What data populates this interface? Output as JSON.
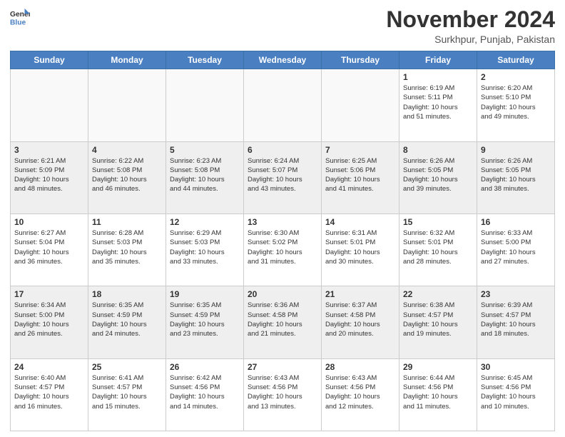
{
  "header": {
    "logo_general": "General",
    "logo_blue": "Blue",
    "month_title": "November 2024",
    "location": "Surkhpur, Punjab, Pakistan"
  },
  "weekdays": [
    "Sunday",
    "Monday",
    "Tuesday",
    "Wednesday",
    "Thursday",
    "Friday",
    "Saturday"
  ],
  "weeks": [
    [
      {
        "day": "",
        "info": ""
      },
      {
        "day": "",
        "info": ""
      },
      {
        "day": "",
        "info": ""
      },
      {
        "day": "",
        "info": ""
      },
      {
        "day": "",
        "info": ""
      },
      {
        "day": "1",
        "info": "Sunrise: 6:19 AM\nSunset: 5:11 PM\nDaylight: 10 hours\nand 51 minutes."
      },
      {
        "day": "2",
        "info": "Sunrise: 6:20 AM\nSunset: 5:10 PM\nDaylight: 10 hours\nand 49 minutes."
      }
    ],
    [
      {
        "day": "3",
        "info": "Sunrise: 6:21 AM\nSunset: 5:09 PM\nDaylight: 10 hours\nand 48 minutes."
      },
      {
        "day": "4",
        "info": "Sunrise: 6:22 AM\nSunset: 5:08 PM\nDaylight: 10 hours\nand 46 minutes."
      },
      {
        "day": "5",
        "info": "Sunrise: 6:23 AM\nSunset: 5:08 PM\nDaylight: 10 hours\nand 44 minutes."
      },
      {
        "day": "6",
        "info": "Sunrise: 6:24 AM\nSunset: 5:07 PM\nDaylight: 10 hours\nand 43 minutes."
      },
      {
        "day": "7",
        "info": "Sunrise: 6:25 AM\nSunset: 5:06 PM\nDaylight: 10 hours\nand 41 minutes."
      },
      {
        "day": "8",
        "info": "Sunrise: 6:26 AM\nSunset: 5:05 PM\nDaylight: 10 hours\nand 39 minutes."
      },
      {
        "day": "9",
        "info": "Sunrise: 6:26 AM\nSunset: 5:05 PM\nDaylight: 10 hours\nand 38 minutes."
      }
    ],
    [
      {
        "day": "10",
        "info": "Sunrise: 6:27 AM\nSunset: 5:04 PM\nDaylight: 10 hours\nand 36 minutes."
      },
      {
        "day": "11",
        "info": "Sunrise: 6:28 AM\nSunset: 5:03 PM\nDaylight: 10 hours\nand 35 minutes."
      },
      {
        "day": "12",
        "info": "Sunrise: 6:29 AM\nSunset: 5:03 PM\nDaylight: 10 hours\nand 33 minutes."
      },
      {
        "day": "13",
        "info": "Sunrise: 6:30 AM\nSunset: 5:02 PM\nDaylight: 10 hours\nand 31 minutes."
      },
      {
        "day": "14",
        "info": "Sunrise: 6:31 AM\nSunset: 5:01 PM\nDaylight: 10 hours\nand 30 minutes."
      },
      {
        "day": "15",
        "info": "Sunrise: 6:32 AM\nSunset: 5:01 PM\nDaylight: 10 hours\nand 28 minutes."
      },
      {
        "day": "16",
        "info": "Sunrise: 6:33 AM\nSunset: 5:00 PM\nDaylight: 10 hours\nand 27 minutes."
      }
    ],
    [
      {
        "day": "17",
        "info": "Sunrise: 6:34 AM\nSunset: 5:00 PM\nDaylight: 10 hours\nand 26 minutes."
      },
      {
        "day": "18",
        "info": "Sunrise: 6:35 AM\nSunset: 4:59 PM\nDaylight: 10 hours\nand 24 minutes."
      },
      {
        "day": "19",
        "info": "Sunrise: 6:35 AM\nSunset: 4:59 PM\nDaylight: 10 hours\nand 23 minutes."
      },
      {
        "day": "20",
        "info": "Sunrise: 6:36 AM\nSunset: 4:58 PM\nDaylight: 10 hours\nand 21 minutes."
      },
      {
        "day": "21",
        "info": "Sunrise: 6:37 AM\nSunset: 4:58 PM\nDaylight: 10 hours\nand 20 minutes."
      },
      {
        "day": "22",
        "info": "Sunrise: 6:38 AM\nSunset: 4:57 PM\nDaylight: 10 hours\nand 19 minutes."
      },
      {
        "day": "23",
        "info": "Sunrise: 6:39 AM\nSunset: 4:57 PM\nDaylight: 10 hours\nand 18 minutes."
      }
    ],
    [
      {
        "day": "24",
        "info": "Sunrise: 6:40 AM\nSunset: 4:57 PM\nDaylight: 10 hours\nand 16 minutes."
      },
      {
        "day": "25",
        "info": "Sunrise: 6:41 AM\nSunset: 4:57 PM\nDaylight: 10 hours\nand 15 minutes."
      },
      {
        "day": "26",
        "info": "Sunrise: 6:42 AM\nSunset: 4:56 PM\nDaylight: 10 hours\nand 14 minutes."
      },
      {
        "day": "27",
        "info": "Sunrise: 6:43 AM\nSunset: 4:56 PM\nDaylight: 10 hours\nand 13 minutes."
      },
      {
        "day": "28",
        "info": "Sunrise: 6:43 AM\nSunset: 4:56 PM\nDaylight: 10 hours\nand 12 minutes."
      },
      {
        "day": "29",
        "info": "Sunrise: 6:44 AM\nSunset: 4:56 PM\nDaylight: 10 hours\nand 11 minutes."
      },
      {
        "day": "30",
        "info": "Sunrise: 6:45 AM\nSunset: 4:56 PM\nDaylight: 10 hours\nand 10 minutes."
      }
    ]
  ]
}
